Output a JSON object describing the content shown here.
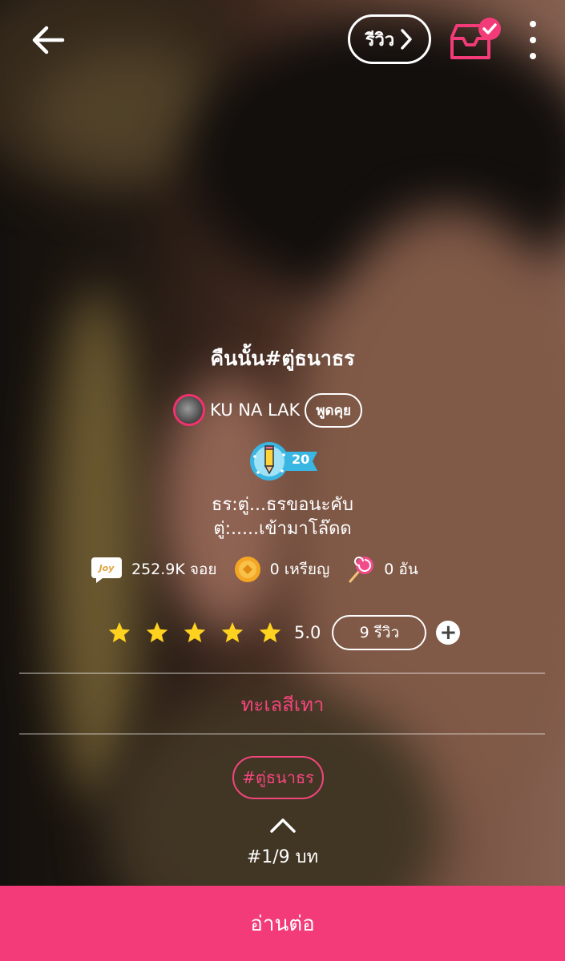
{
  "top_bar": {
    "review_label": "รีวิว"
  },
  "story": {
    "title": "คืนนั้น#ตู่ธนาธร",
    "author": "KU NA LAK",
    "talk_label": "พูดคุย",
    "level": "20",
    "description_line1": "ธร:ตู่...ธรขอนะคับ",
    "description_line2": "ตู่:.....เข้ามาโล๊ดด"
  },
  "stats": {
    "joy_icon_text": "Joy",
    "joy": "252.9K จอย",
    "coins": "0 เหรียญ",
    "candy": "0 อัน"
  },
  "rating": {
    "stars": 5,
    "value": "5.0",
    "reviews_label": "9 รีวิว",
    "add_symbol": "+"
  },
  "category": "ทะเลสีเทา",
  "tag": "#ตู่ธนาธร",
  "chapter": "#1/9 บท",
  "cta": "อ่านต่อ",
  "colors": {
    "accent": "#f23b78",
    "tag": "#f2467c"
  },
  "icons": [
    "arrow-left-icon",
    "chevron-right-icon",
    "inbox-check-icon",
    "more-vertical-icon",
    "pencil-badge-icon",
    "joy-icon",
    "coin-icon",
    "candy-icon",
    "star-icon",
    "plus-icon",
    "chevron-up-icon"
  ]
}
